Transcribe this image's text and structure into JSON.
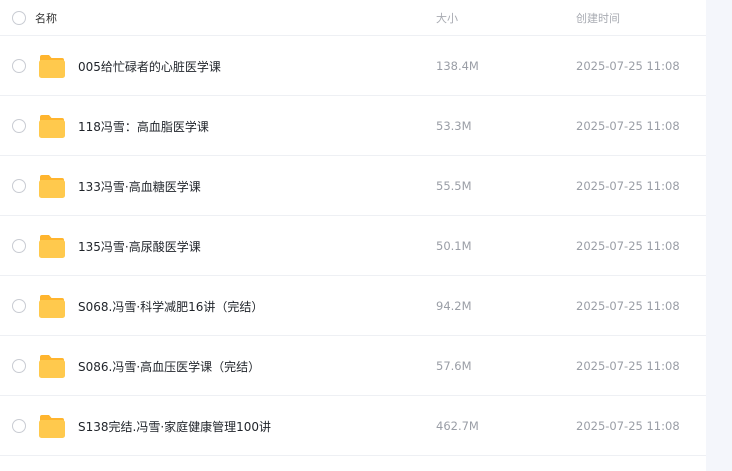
{
  "columns": {
    "name": "名称",
    "size": "大小",
    "created": "创建时间"
  },
  "files": [
    {
      "icon": "folder-icon",
      "name": "005给忙碌者的心脏医学课",
      "size": "138.4M",
      "created": "2025-07-25 11:08"
    },
    {
      "icon": "folder-icon",
      "name": "118冯雪：高血脂医学课",
      "size": "53.3M",
      "created": "2025-07-25 11:08"
    },
    {
      "icon": "folder-icon",
      "name": "133冯雪·高血糖医学课",
      "size": "55.5M",
      "created": "2025-07-25 11:08"
    },
    {
      "icon": "folder-icon",
      "name": "135冯雪·高尿酸医学课",
      "size": "50.1M",
      "created": "2025-07-25 11:08"
    },
    {
      "icon": "folder-icon",
      "name": "S068.冯雪·科学减肥16讲（完结）",
      "size": "94.2M",
      "created": "2025-07-25 11:08"
    },
    {
      "icon": "folder-icon",
      "name": "S086.冯雪·高血压医学课（完结）",
      "size": "57.6M",
      "created": "2025-07-25 11:08"
    },
    {
      "icon": "folder-icon",
      "name": "S138完结.冯雪·家庭健康管理100讲",
      "size": "462.7M",
      "created": "2025-07-25 11:08"
    }
  ],
  "colors": {
    "folder_body": "#ffc94d",
    "folder_tab": "#ffb52e",
    "divider": "#eef0f4",
    "muted_text": "#9a9ea6"
  }
}
